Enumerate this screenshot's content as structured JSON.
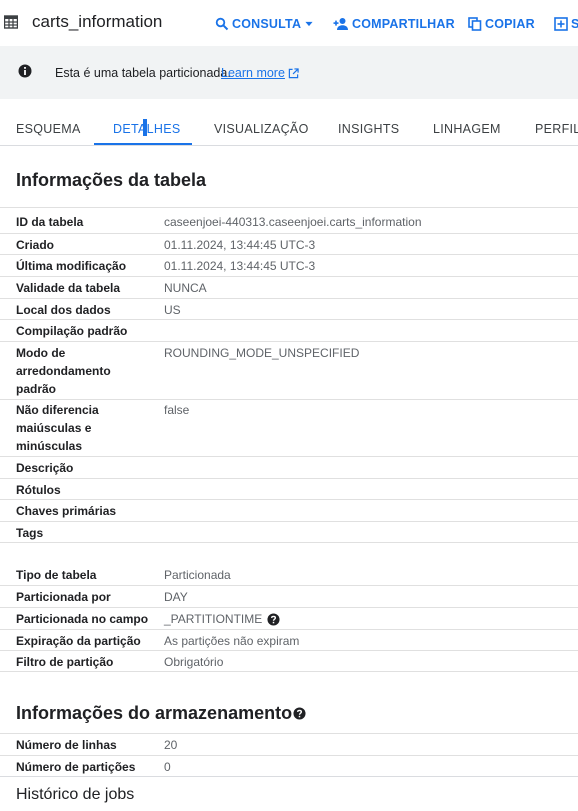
{
  "header": {
    "title": "carts_information",
    "buttons": {
      "consulta": "CONSULTA",
      "compartilhar": "COMPARTILHAR",
      "copiar": "COPIAR",
      "snapshot": "SI"
    }
  },
  "banner": {
    "text": "Esta é uma tabela particionada.",
    "link": "Learn more"
  },
  "tabs": [
    {
      "label": "ESQUEMA"
    },
    {
      "label": "DETALHES"
    },
    {
      "label": "VISUALIZAÇÃO"
    },
    {
      "label": "INSIGHTS"
    },
    {
      "label": "LINHAGEM"
    },
    {
      "label": "PERFIL I"
    }
  ],
  "table_info": {
    "heading": "Informações da tabela",
    "rows": [
      {
        "key": "ID da tabela",
        "value": "caseenjoei-440313.caseenjoei.carts_information"
      },
      {
        "key": "Criado",
        "value": "01.11.2024, 13:44:45 UTC-3"
      },
      {
        "key": "Última modificação",
        "value": "01.11.2024, 13:44:45 UTC-3"
      },
      {
        "key": "Validade da tabela",
        "value": "NUNCA"
      },
      {
        "key": "Local dos dados",
        "value": "US"
      },
      {
        "key": "Compilação padrão",
        "value": ""
      },
      {
        "key": "Modo de arredondamento padrão",
        "value": "ROUNDING_MODE_UNSPECIFIED"
      },
      {
        "key": "Não diferencia maiúsculas e minúsculas",
        "value": "false"
      },
      {
        "key": "Descrição",
        "value": ""
      },
      {
        "key": "Rótulos",
        "value": ""
      },
      {
        "key": "Chaves primárias",
        "value": ""
      },
      {
        "key": "Tags",
        "value": ""
      }
    ],
    "partition_rows": [
      {
        "key": "Tipo de tabela",
        "value": "Particionada"
      },
      {
        "key": "Particionada por",
        "value": "DAY"
      },
      {
        "key": "Particionada no campo",
        "value": "_PARTITIONTIME"
      },
      {
        "key": "Expiração da partição",
        "value": "As partições não expiram"
      },
      {
        "key": "Filtro de partição",
        "value": "Obrigatório"
      }
    ]
  },
  "storage_info": {
    "heading": "Informações do armazenamento",
    "rows": [
      {
        "key": "Número de linhas",
        "value": "20"
      },
      {
        "key": "Número de partições",
        "value": "0"
      }
    ]
  },
  "footer": {
    "title": "Histórico de jobs"
  },
  "colors": {
    "accent": "#1a73e8",
    "banner_bg": "#f1f3f4",
    "text": "#202124",
    "muted": "#5f6368"
  }
}
